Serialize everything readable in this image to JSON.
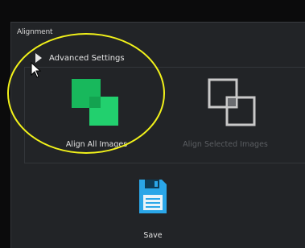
{
  "section": {
    "title": "Alignment"
  },
  "advanced": {
    "label": "Advanced Settings"
  },
  "tools": {
    "align_all": {
      "label": "Align All Images"
    },
    "align_selected": {
      "label": "Align Selected Images"
    }
  },
  "save": {
    "label": "Save"
  },
  "colors": {
    "panel_bg": "#222427",
    "accent_green": "#1fc46a",
    "save_blue": "#2aa6e8",
    "annotation_yellow": "#f2f21a"
  }
}
